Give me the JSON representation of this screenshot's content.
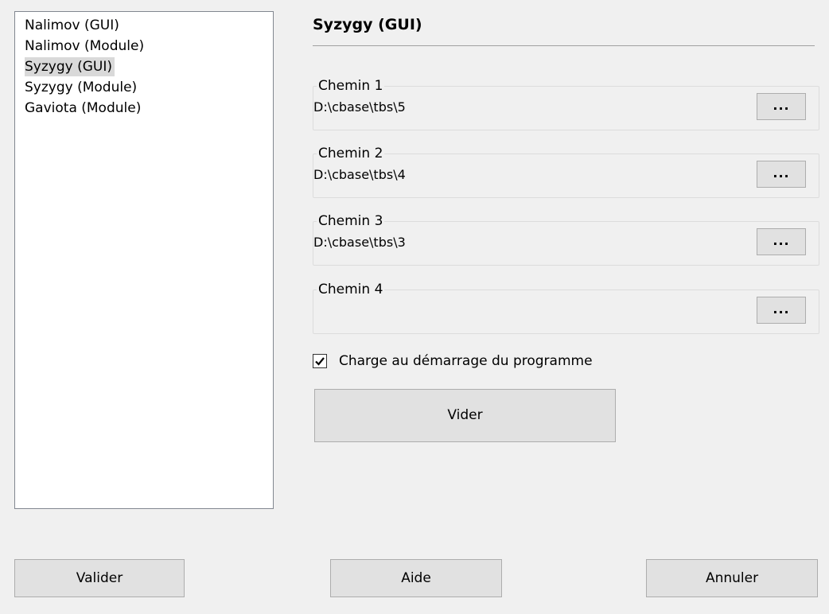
{
  "list": {
    "items": [
      "Nalimov (GUI)",
      "Nalimov (Module)",
      "Syzygy (GUI)",
      "Syzygy (Module)",
      "Gaviota (Module)"
    ],
    "selected": "Syzygy (GUI)"
  },
  "panel": {
    "title": "Syzygy (GUI)",
    "paths": [
      {
        "label": "Chemin 1",
        "value": "D:\\cbase\\tbs\\5",
        "button": "..."
      },
      {
        "label": "Chemin 2",
        "value": "D:\\cbase\\tbs\\4",
        "button": "..."
      },
      {
        "label": "Chemin 3",
        "value": "D:\\cbase\\tbs\\3",
        "button": "..."
      },
      {
        "label": "Chemin 4",
        "value": "",
        "button": "..."
      }
    ],
    "load_on_start": {
      "label": "Charge au démarrage du programme",
      "checked": true
    },
    "clear_button": "Vider"
  },
  "footer": {
    "ok_button": "Valider",
    "help_button": "Aide",
    "cancel_button": "Annuler"
  }
}
